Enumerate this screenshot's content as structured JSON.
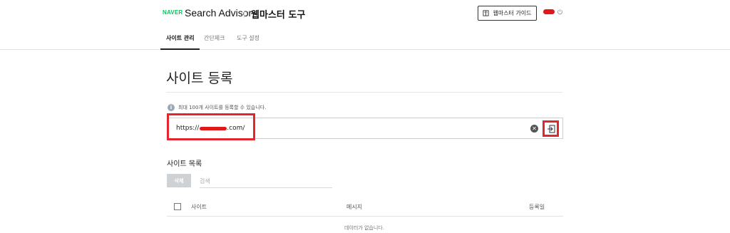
{
  "header": {
    "logo_text": "NAVER",
    "product": "Search Advisor",
    "tool_title": "웹마스터 도구",
    "guide_button_label": "웹마스터 가이드",
    "icons": {
      "guide": "book-icon",
      "logout": "power-icon"
    },
    "accent_color": "#03c75a"
  },
  "tabs": [
    {
      "label": "사이트 관리"
    },
    {
      "label": "간단체크"
    },
    {
      "label": "도구 설정"
    }
  ],
  "main": {
    "title": "사이트 등록",
    "notice": "최대 100개 사이트를 등록할 수 있습니다.",
    "url_input": {
      "value_prefix": "https://",
      "value_suffix": ".com/"
    },
    "list_title": "사이트 목록",
    "delete_label": "삭제",
    "search_placeholder": "검색",
    "columns": [
      "사이트",
      "메시지",
      "등록일"
    ],
    "empty_message": "데이터가 없습니다.",
    "highlight_color": "#e3262e"
  }
}
